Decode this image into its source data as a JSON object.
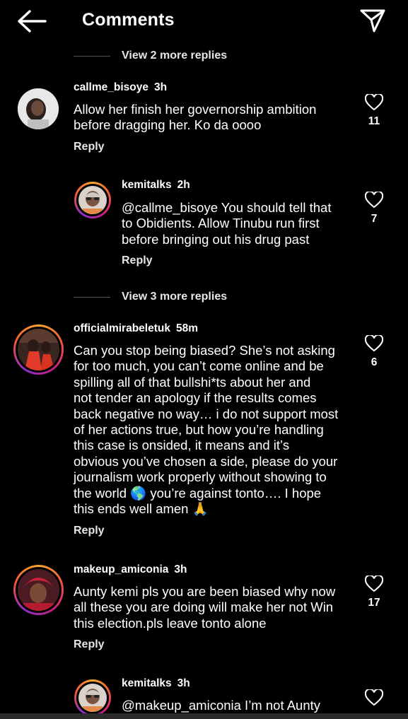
{
  "header": {
    "title": "Comments"
  },
  "view_more_1": "View 2 more replies",
  "view_more_2": "View 3 more replies",
  "comments": [
    {
      "username": "callme_bisoye",
      "time": "3h",
      "lines": [
        "Allow her finish her governorship ambition",
        "before dragging her. Ko da oooo"
      ],
      "reply": "Reply",
      "likes": "11"
    },
    {
      "username": "kemitalks",
      "time": "2h",
      "lines": [
        "@callme_bisoye You should tell that",
        "to Obidients. Allow Tinubu run first",
        "before bringing out his drug past"
      ],
      "reply": "Reply",
      "likes": "7"
    },
    {
      "username": "officialmirabeletuk",
      "time": "58m",
      "lines": [
        "Can you stop being biased? She’s not asking",
        "for too much, you can’t come online and be",
        "spilling all of that bullshi*ts about her and",
        "not tender an apology if the results comes",
        "back negative no way… i do not support most",
        "of her actions true, but how you’re handling",
        "this case is onsided, it means and it’s",
        "obvious you’ve chosen a side, please do your",
        "journalism work properly without showing to",
        "the world 🌎 you’re against tonto…. I hope",
        "this ends well amen 🙏"
      ],
      "reply": "Reply",
      "likes": "6"
    },
    {
      "username": "makeup_amiconia",
      "time": "3h",
      "lines": [
        "Aunty kemi pls you are been biased why now",
        "all these you are doing will make her not Win",
        "this election.pls leave tonto alone"
      ],
      "reply": "Reply",
      "likes": "17"
    },
    {
      "username": "kemitalks",
      "time": "3h",
      "lines": [
        "@makeup_amiconia I’m not Aunty"
      ],
      "reply": "",
      "likes": ""
    }
  ],
  "icons": {
    "back": "arrow-left-icon",
    "send": "send-paper-plane-icon",
    "like": "heart-outline-icon"
  },
  "colors": {
    "background": "#000000",
    "text": "#ffffff",
    "story_ring": [
      "#f9a72b",
      "#f2543a",
      "#c41f87",
      "#8a2ec7"
    ]
  }
}
